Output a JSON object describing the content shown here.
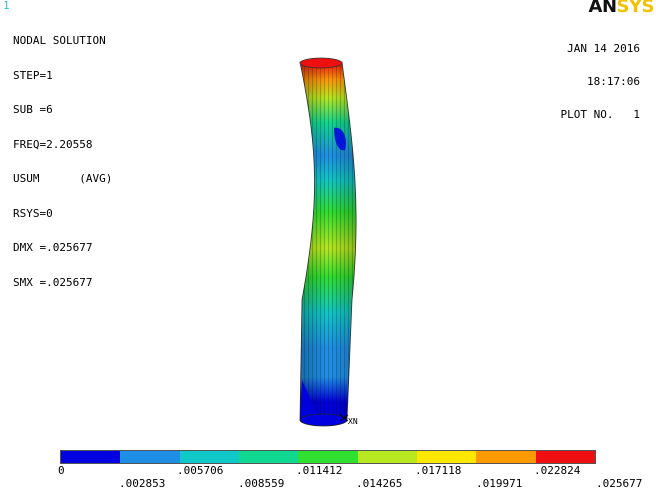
{
  "window_number": "1",
  "header": {
    "title": "NODAL SOLUTION",
    "lines": [
      "STEP=1",
      "SUB =6",
      "FREQ=2.20558",
      "USUM      (AVG)",
      "RSYS=0",
      "DMX =.025677",
      "SMX =.025677"
    ]
  },
  "logo": {
    "an": "AN",
    "sys": "SYS"
  },
  "datebox": {
    "date": "JAN 14 2016",
    "time": "18:17:06",
    "plot": "PLOT NO.   1"
  },
  "triad_label": "XN",
  "legend": {
    "colors": [
      "#0000e0",
      "#1f8fe6",
      "#10c8c8",
      "#10d890",
      "#30e030",
      "#b8e820",
      "#ffe800",
      "#ff9900",
      "#ee1010"
    ],
    "ticks_top": [
      "0",
      ".005706",
      ".011412",
      ".017118",
      ".022824"
    ],
    "ticks_bottom": [
      ".002853",
      ".008559",
      ".014265",
      ".019971",
      ".025677"
    ]
  }
}
